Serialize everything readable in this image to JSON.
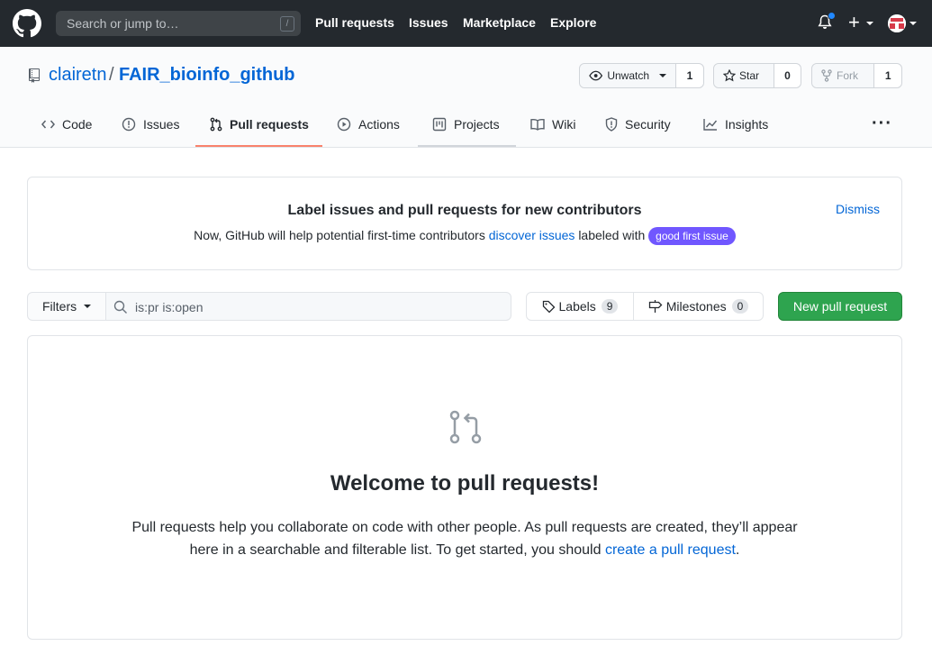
{
  "header": {
    "search_placeholder": "Search or jump to…",
    "search_shortcut": "/",
    "nav": [
      "Pull requests",
      "Issues",
      "Marketplace",
      "Explore"
    ]
  },
  "repo": {
    "owner": "clairetn",
    "separator": "/",
    "name": "FAIR_bioinfo_github",
    "unwatch_label": "Unwatch",
    "unwatch_count": "1",
    "star_label": "Star",
    "star_count": "0",
    "fork_label": "Fork",
    "fork_count": "1"
  },
  "tabs": [
    {
      "label": "Code",
      "icon": "code-icon"
    },
    {
      "label": "Issues",
      "icon": "issue-icon"
    },
    {
      "label": "Pull requests",
      "icon": "pull-request-icon",
      "selected": true
    },
    {
      "label": "Actions",
      "icon": "play-icon"
    },
    {
      "label": "Projects",
      "icon": "project-icon"
    },
    {
      "label": "Wiki",
      "icon": "book-icon"
    },
    {
      "label": "Security",
      "icon": "shield-icon"
    },
    {
      "label": "Insights",
      "icon": "graph-icon"
    }
  ],
  "banner": {
    "title": "Label issues and pull requests for new contributors",
    "text_before": "Now, GitHub will help potential first-time contributors",
    "link": "discover issues",
    "text_after": "labeled with",
    "label": "good first issue",
    "dismiss": "Dismiss"
  },
  "filterbar": {
    "filters_label": "Filters",
    "query": "is:pr is:open",
    "labels_label": "Labels",
    "labels_count": "9",
    "milestones_label": "Milestones",
    "milestones_count": "0",
    "new_pr_label": "New pull request"
  },
  "blankslate": {
    "title": "Welcome to pull requests!",
    "text": "Pull requests help you collaborate on code with other people. As pull requests are created, they’ll appear here in a searchable and filterable list. To get started, you should",
    "link": "create a pull request",
    "end": "."
  },
  "colors": {
    "header_bg": "#24292e",
    "link": "#0366d6",
    "primary_button": "#2ea44f",
    "selected_tab_underline": "#f9826c",
    "good_first_issue": "#7057ff"
  }
}
